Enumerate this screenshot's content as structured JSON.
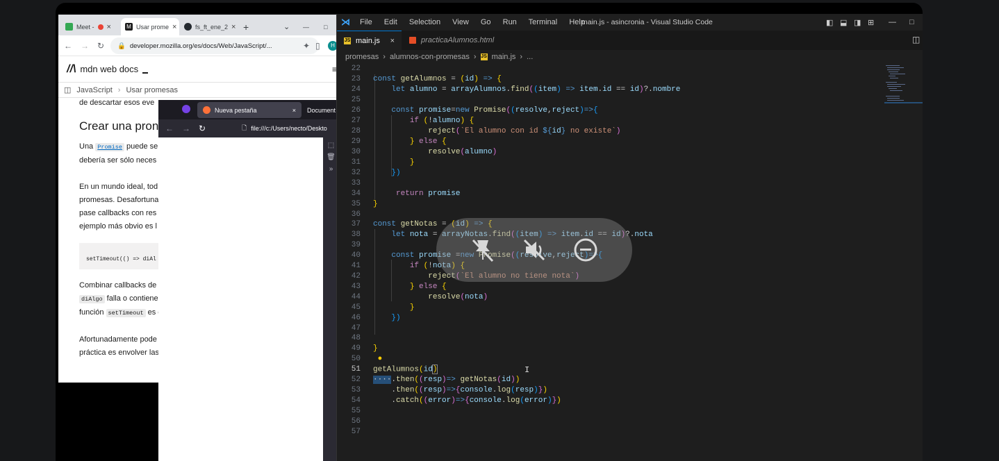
{
  "chrome": {
    "tabs": [
      "Meet -",
      "Usar prome",
      "fs_ft_ene_2"
    ],
    "new_tab": "+",
    "url": "developer.mozilla.org/es/docs/Web/JavaScript/...",
    "logo": "mdn web docs",
    "breadcrumbs": [
      "JavaScript",
      "Usar promesas"
    ],
    "article": {
      "intro_line": "de descartar esos eve",
      "heading": "Crear una pron de callbacks",
      "p1a": "Una",
      "p1code": "Promise",
      "p1b": "puede ser",
      "p1c": "debería ser sólo neces",
      "p2a": "En un mundo ideal, tod",
      "p2b": "promesas. Desafortuna",
      "p2c": "pase callbacks con res",
      "p2d": "ejemplo más obvio es l",
      "codeblock": "setTimeout(() => diAl",
      "p3a": "Combinar callbacks de",
      "p3code": "diAlgo",
      "p3b": "falla o contiene",
      "p3c": "función",
      "p3code2": "setTimeout",
      "p3d": "es c",
      "p4a": "Afortunadamente pode",
      "p4b": "práctica es envolver las"
    }
  },
  "firefox": {
    "tabs": [
      "Nueva pestaña",
      "Document"
    ],
    "url": "file:///c:/Users/necto/Deskto"
  },
  "vscode": {
    "menu": [
      "File",
      "Edit",
      "Selection",
      "View",
      "Go",
      "Run",
      "Terminal",
      "Help"
    ],
    "window_title": "main.js - asincronia - Visual Studio Code",
    "tabs": [
      "main.js",
      "practicaAlumnos.html"
    ],
    "breadcrumb": [
      "promesas",
      "alumnos-con-promesas",
      "main.js",
      "..."
    ],
    "line_numbers": [
      "22",
      "23",
      "24",
      "25",
      "26",
      "27",
      "28",
      "29",
      "30",
      "31",
      "32",
      "33",
      "34",
      "35",
      "36",
      "37",
      "38",
      "39",
      "40",
      "41",
      "42",
      "43",
      "44",
      "45",
      "46",
      "47",
      "48",
      "49",
      "50",
      "51",
      "52",
      "53",
      "54",
      "55",
      "56",
      "57"
    ],
    "current_line": "51"
  },
  "colors": {
    "vscode_accent": "#0078d4",
    "js_icon": "#e8c02a",
    "mdn_link": "#0069c2"
  }
}
